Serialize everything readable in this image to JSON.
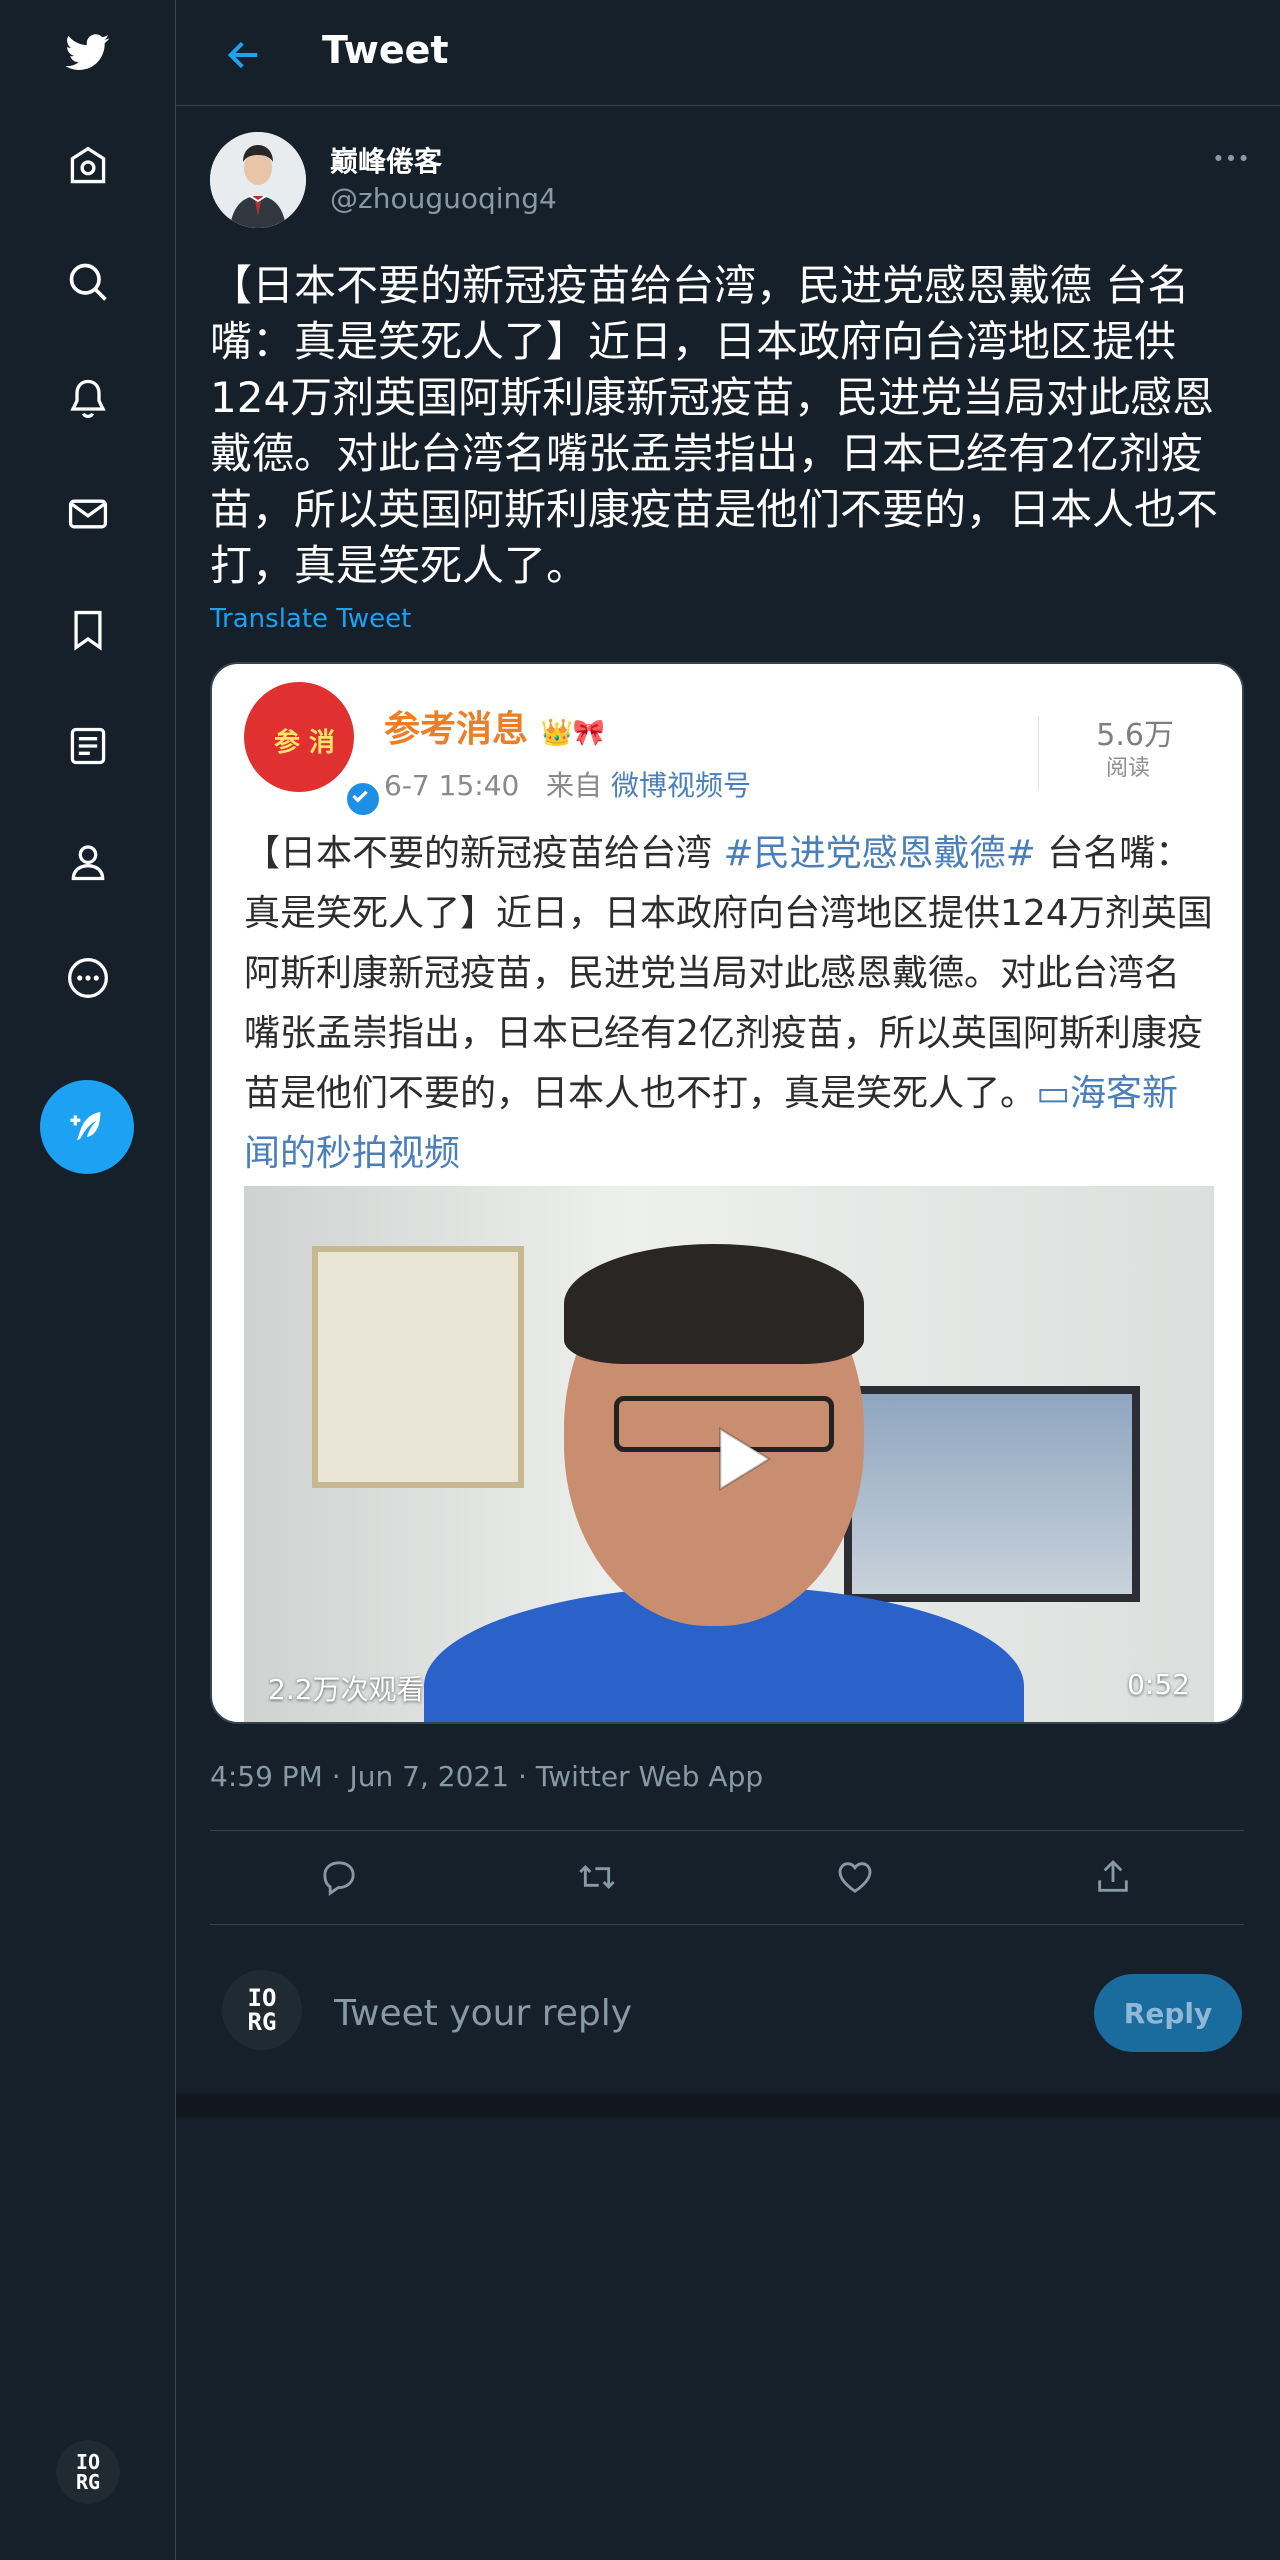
{
  "header": {
    "title": "Tweet"
  },
  "author": {
    "name": "巅峰倦客",
    "handle": "@zhouguoqing4"
  },
  "tweet": {
    "text": "【日本不要的新冠疫苗给台湾，民进党感恩戴德  台名嘴：真是笑死人了】近日，日本政府向台湾地区提供124万剂英国阿斯利康新冠疫苗，民进党当局对此感恩戴德。对此台湾名嘴张孟崇指出，日本已经有2亿剂疫苗，所以英国阿斯利康疫苗是他们不要的，日本人也不打，真是笑死人了。",
    "translate_label": "Translate Tweet",
    "timestamp": "4:59 PM · Jun 7, 2021 · Twitter Web App"
  },
  "embed": {
    "account_name": "参考消息",
    "account_badges": "👑🎀",
    "avatar_chars": "参 消",
    "date": "6-7 15:40",
    "source_prefix": "来自",
    "source": "微博视频号",
    "views_count": "5.6万",
    "views_label": "阅读",
    "text_before": "【日本不要的新冠疫苗给台湾 ",
    "hashtag": "#民进党感恩戴德#",
    "text_after": " 台名嘴：真是笑死人了】近日，日本政府向台湾地区提供124万剂英国阿斯利康新冠疫苗，民进党当局对此感恩戴德。对此台湾名嘴张孟崇指出，日本已经有2亿剂疫苗，所以英国阿斯利康疫苗是他们不要的，日本人也不打，真是笑死人了。",
    "video_link": "▭海客新闻的秒拍视频",
    "video_views": "2.2万次观看",
    "video_duration": "0:52"
  },
  "reply": {
    "placeholder": "Tweet your reply",
    "button_label": "Reply",
    "avatar_line1": "IO",
    "avatar_line2": "RG"
  },
  "sidebar": {
    "items": [
      "twitter-logo-icon",
      "home-icon",
      "explore-icon",
      "notifications-icon",
      "messages-icon",
      "bookmarks-icon",
      "lists-icon",
      "profile-icon",
      "more-icon"
    ],
    "avatar_line1": "IO",
    "avatar_line2": "RG"
  },
  "colors": {
    "accent": "#1da1f2",
    "background": "#15202b",
    "border": "#38444d",
    "muted": "#8899a6"
  }
}
